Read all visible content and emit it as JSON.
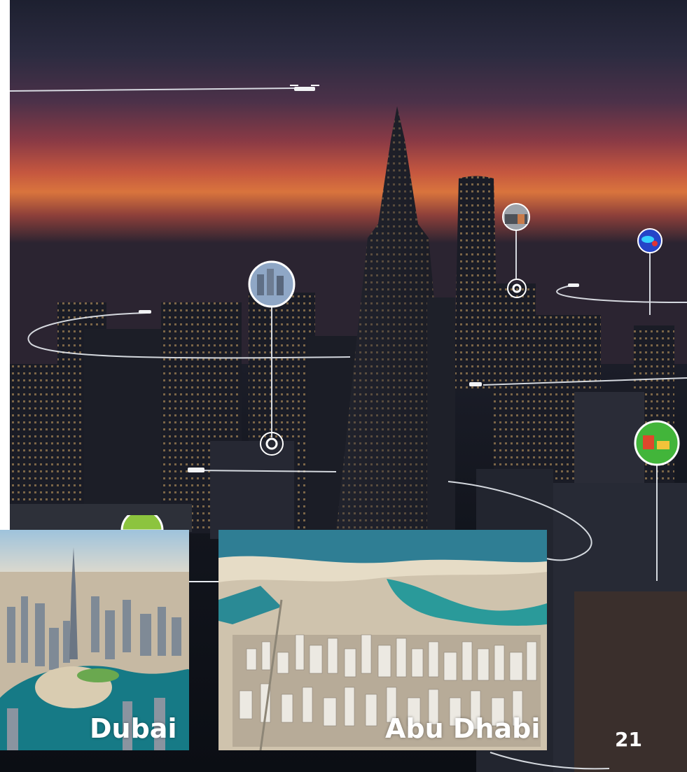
{
  "photos": [
    {
      "label": "Dubai"
    },
    {
      "label": "Abu Dhabi"
    }
  ],
  "page_number": "21",
  "icons": [
    "drone-icon",
    "sensor-bubble-icon",
    "heatmap-bubble-icon",
    "target-ring-icon"
  ],
  "colors": {
    "sky_glow": "#d9743d",
    "line": "#e8ecf2",
    "label": "#ffffff"
  }
}
